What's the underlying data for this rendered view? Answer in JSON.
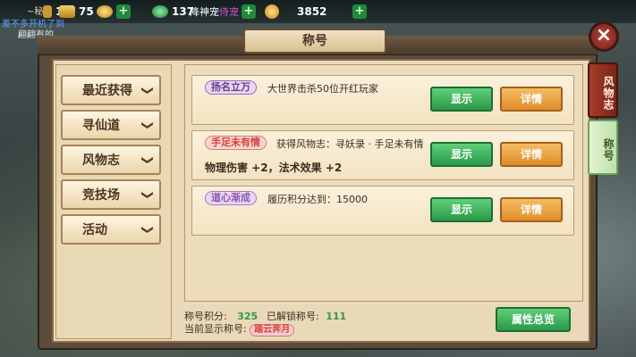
{
  "topbar": {
    "gold_small": "1",
    "gold": "75",
    "gem_text": "137",
    "event_text": "降神宠",
    "event_text2": "侍宠",
    "currency": "3852",
    "bg_chat_1": "~秘",
    "bg_chat_2": "差不多开机了到",
    "bg_chat_3": "翩翩有的"
  },
  "dialog": {
    "title": "称号",
    "close_icon": "×"
  },
  "nav": [
    {
      "label": "最近获得",
      "chev": "❯"
    },
    {
      "label": "寻仙道",
      "chev": "❯"
    },
    {
      "label": "风物志",
      "chev": "❯"
    },
    {
      "label": "竞技场",
      "chev": "❯"
    },
    {
      "label": "活动",
      "chev": "❯"
    }
  ],
  "cards": [
    {
      "tag": "扬名立万",
      "desc": "大世界击杀50位开红玩家",
      "extra": "",
      "show": "显示",
      "detail": "详情"
    },
    {
      "tag": "手足未有情",
      "desc": "获得风物志：寻妖录 · 手足未有情",
      "extra": "物理伤害 +2，法术效果 +2",
      "show": "显示",
      "detail": "详情"
    },
    {
      "tag": "道心渐成",
      "desc": "履历积分达到：15000",
      "extra": "",
      "show": "显示",
      "detail": "详情"
    }
  ],
  "footer": {
    "score_label": "称号积分:",
    "score_value": "325",
    "unlocked_label": "已解锁称号:",
    "unlocked_value": "111",
    "current_label": "当前显示称号:",
    "current_value": "踏云奔月",
    "overview_button": "属性总览"
  },
  "side_tabs": {
    "tab1": "风物志",
    "tab2": "称号"
  },
  "colors": {
    "accent_green": "#2a9a4a",
    "accent_orange": "#e08c29",
    "panel_bg": "#ead9b8"
  }
}
